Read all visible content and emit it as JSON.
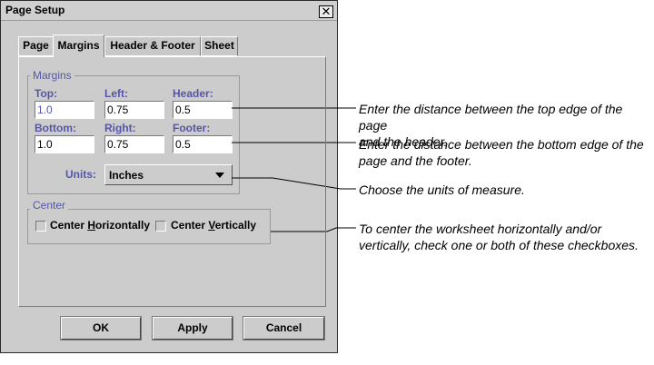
{
  "window": {
    "title": "Page Setup",
    "close_glyph": "✕"
  },
  "tabs": [
    {
      "label": "Page",
      "active": false
    },
    {
      "label": "Margins",
      "active": true
    },
    {
      "label": "Header & Footer",
      "active": false
    },
    {
      "label": "Sheet",
      "active": false
    }
  ],
  "margins": {
    "group_title": "Margins",
    "top_label": "Top:",
    "top_value": "1.0",
    "left_label": "Left:",
    "left_value": "0.75",
    "header_label": "Header:",
    "header_value": "0.5",
    "bottom_label": "Bottom:",
    "bottom_value": "1.0",
    "right_label": "Right:",
    "right_value": "0.75",
    "footer_label": "Footer:",
    "footer_value": "0.5",
    "units_label": "Units:",
    "units_value": "Inches"
  },
  "center": {
    "group_title": "Center",
    "horizontally_pre": "Center ",
    "horizontally_mnemonic": "H",
    "horizontally_post": "orizontally",
    "horizontally_checked": false,
    "vertically_pre": "Center ",
    "vertically_mnemonic": "V",
    "vertically_post": "ertically",
    "vertically_checked": false
  },
  "buttons": {
    "ok": "OK",
    "apply": "Apply",
    "cancel": "Cancel"
  },
  "annotations": {
    "header": [
      "Enter the distance between the top edge of the page",
      "and the header."
    ],
    "footer": [
      "Enter the distance between the bottom edge of the",
      "page and the footer."
    ],
    "units": [
      "Choose the units of measure."
    ],
    "center": [
      "To center the worksheet horizontally and/or",
      "vertically, check one or both of these checkboxes."
    ]
  }
}
